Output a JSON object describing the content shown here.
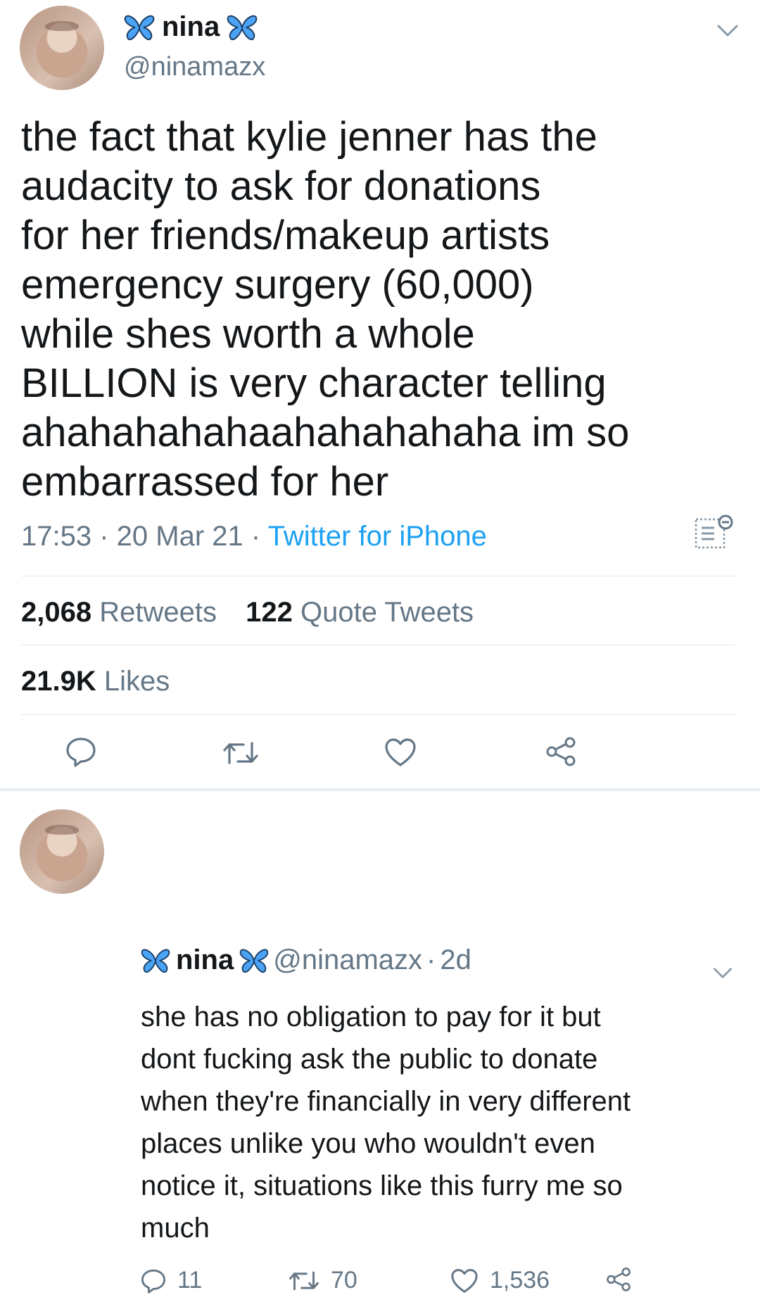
{
  "tweet": {
    "author_name": "nina",
    "author_handle": "@ninamazx",
    "text": "the fact that kylie jenner has the\naudacity to ask for donations\nfor her friends/makeup artists\nemergency surgery (60,000)\nwhile shes worth a whole\nBILLION is very character telling\nahahahahahaahahahahaha im so\nembarrassed for her",
    "time": "17:53",
    "date": "20 Mar 21",
    "source": "Twitter for iPhone",
    "retweets_count": "2,068",
    "retweets_label": "Retweets",
    "quotes_count": "122",
    "quotes_label": "Quote Tweets",
    "likes_count": "21.9K",
    "likes_label": "Likes"
  },
  "reply": {
    "author_name": "nina",
    "author_handle": "@ninamazx",
    "age": "2d",
    "text": "she has no obligation to pay for it but\ndont fucking ask the public to donate\nwhen they're financially in very different\nplaces unlike you who wouldn't even\nnotice it, situations like this furry me so\nmuch",
    "reply_count": "11",
    "retweet_count": "70",
    "like_count": "1,536"
  },
  "icons": [
    "butterfly-icon",
    "chevron-down-icon",
    "analytics-icon",
    "reply-icon",
    "retweet-icon",
    "like-icon",
    "share-icon"
  ],
  "colors": {
    "text": "#14171a",
    "secondary": "#657786",
    "link": "#1da1f2",
    "butterfly": "#4aa3f5",
    "divider": "#e1e8ed"
  }
}
